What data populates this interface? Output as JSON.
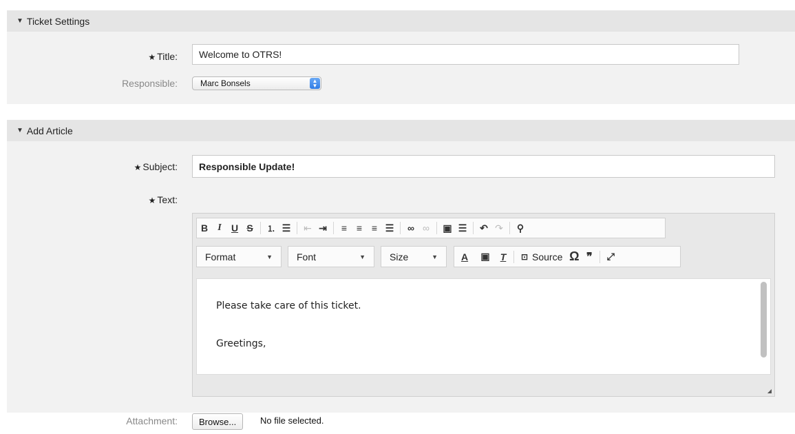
{
  "ticket_settings": {
    "header": "Ticket Settings",
    "title_label": "Title:",
    "title_value": "Welcome to OTRS!",
    "responsible_label": "Responsible:",
    "responsible_value": "Marc Bonsels"
  },
  "add_article": {
    "header": "Add Article",
    "subject_label": "Subject:",
    "subject_value": "Responsible Update!",
    "text_label": "Text:",
    "toolbar": {
      "format": "Format",
      "font": "Font",
      "size": "Size",
      "source": "Source"
    },
    "body_lines": [
      "Please take care of this ticket.",
      "Greetings,"
    ],
    "attachment_label": "Attachment:",
    "browse_label": "Browse...",
    "no_file": "No file selected."
  },
  "required_marker": "★",
  "colors": {
    "header_bg": "#e5e5e5",
    "body_bg": "#f2f2f2",
    "accent": "#2f7ce6"
  }
}
